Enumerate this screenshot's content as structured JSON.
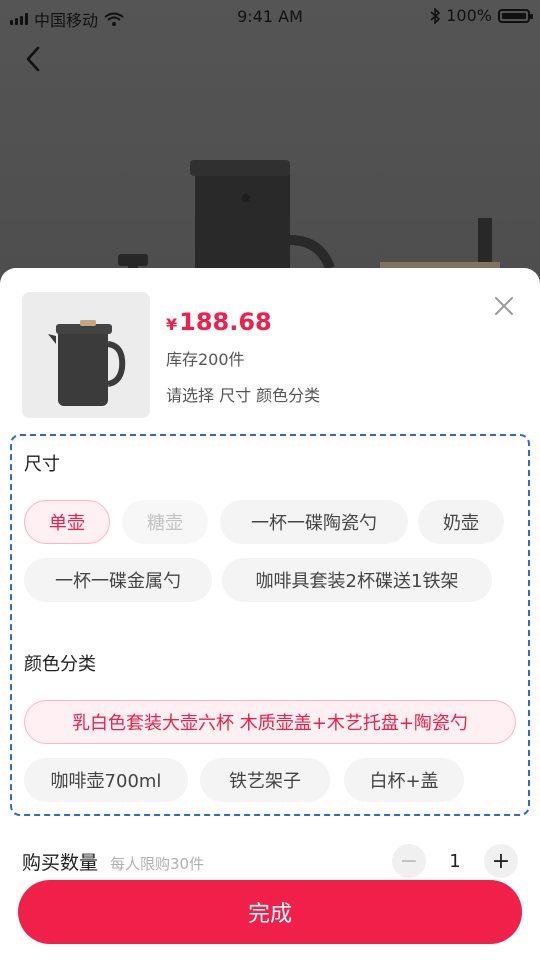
{
  "status": {
    "carrier": "中国移动",
    "time": "9:41 AM",
    "battery": "100%",
    "icons": [
      "signal-icon",
      "wifi-icon",
      "bluetooth-icon",
      "battery-icon"
    ]
  },
  "nav": {
    "back_icon": "chevron-left-icon"
  },
  "product": {
    "currency": "¥",
    "price": "188.68",
    "stock": "库存200件",
    "select_hint": "请选择  尺寸 颜色分类"
  },
  "options": {
    "size": {
      "title": "尺寸",
      "items": [
        {
          "label": "单壶",
          "state": "selected"
        },
        {
          "label": "糖壶",
          "state": "disabled"
        },
        {
          "label": "一杯一碟陶瓷勺",
          "state": "normal"
        },
        {
          "label": "奶壶",
          "state": "normal"
        },
        {
          "label": "一杯一碟金属勺",
          "state": "normal"
        },
        {
          "label": "咖啡具套装2杯碟送1铁架",
          "state": "normal"
        }
      ]
    },
    "color": {
      "title": "颜色分类",
      "items": [
        {
          "label": "乳白色套装大壶六杯 木质壶盖+木艺托盘+陶瓷勺",
          "state": "selected"
        },
        {
          "label": "咖啡壶700ml",
          "state": "normal"
        },
        {
          "label": "铁艺架子",
          "state": "normal"
        },
        {
          "label": "白杯+盖",
          "state": "normal"
        }
      ]
    }
  },
  "quantity": {
    "label": "购买数量",
    "limit": "每人限购30件",
    "value": "1",
    "minus": "−",
    "plus": "+"
  },
  "action": {
    "done_label": "完成"
  },
  "colors": {
    "accent": "#f0204b",
    "selected_bg": "#fff0f3",
    "dashed_border": "#2a6bd8"
  }
}
